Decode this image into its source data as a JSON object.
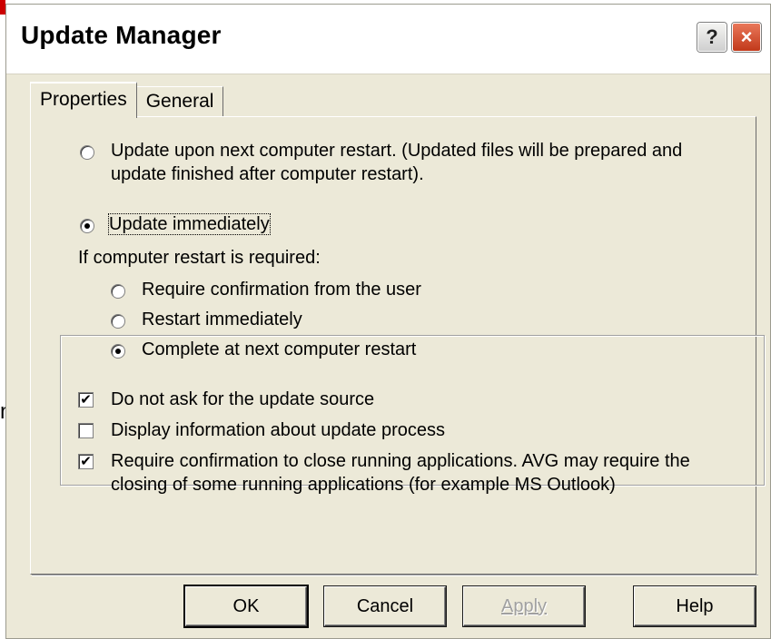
{
  "background": {
    "partial_text": "n"
  },
  "window": {
    "title": "Update Manager",
    "help_glyph": "?",
    "close_glyph": "×"
  },
  "tabs": [
    {
      "label": "Properties",
      "active": true
    },
    {
      "label": "General",
      "active": false
    }
  ],
  "options": {
    "restart_update": {
      "line1": "Update upon next computer restart. (Updated files will be prepared and",
      "line2": "update finished after computer restart).",
      "checked": false
    },
    "immediate_group": {
      "legend": "Update immediately",
      "checked": true,
      "prompt": "If computer restart is required:",
      "choices": [
        {
          "label": "Require confirmation from the user",
          "checked": false
        },
        {
          "label": "Restart immediately",
          "checked": false
        },
        {
          "label": "Complete at next computer restart",
          "checked": true
        }
      ]
    },
    "checkboxes": [
      {
        "label": "Do not ask for the update source",
        "checked": true
      },
      {
        "label": "Display information about update process",
        "checked": false
      },
      {
        "line1": "Require confirmation to close running applications. AVG may require the",
        "line2": "closing of some running applications (for example MS Outlook)",
        "checked": true
      }
    ]
  },
  "buttons": {
    "ok": "OK",
    "cancel": "Cancel",
    "apply": "Apply",
    "help": "Help"
  },
  "colors": {
    "dialog_face": "#ece9d8",
    "close_button": "#c1391a",
    "disabled_text": "#a0a0a0"
  }
}
